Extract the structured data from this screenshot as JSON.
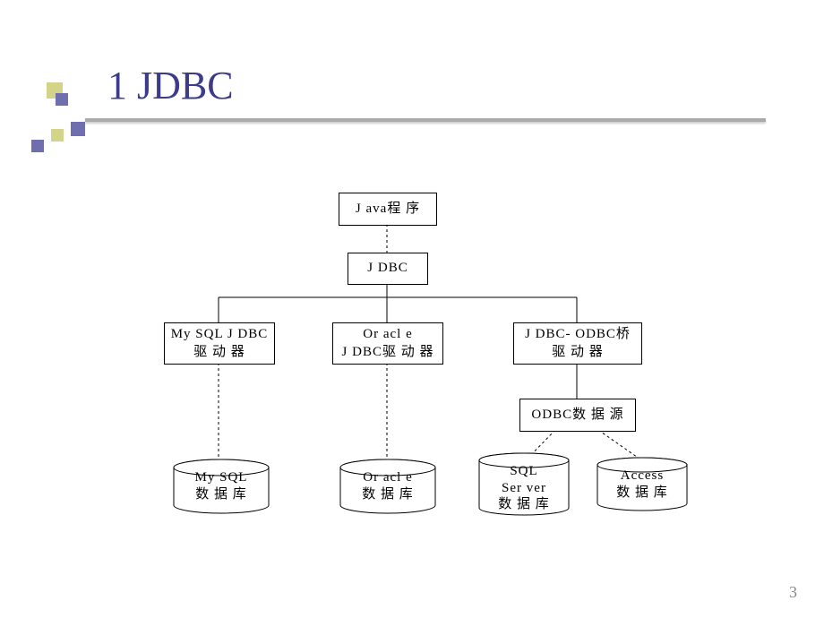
{
  "title": "1 JDBC",
  "page_number": "3",
  "nodes": {
    "java_program": "J ava程 序",
    "jdbc": "J DBC",
    "mysql_driver_l1": "My SQL J DBC",
    "mysql_driver_l2": "驱 动 器",
    "oracle_driver_l1": "Or acl e",
    "oracle_driver_l2": "J DBC驱 动 器",
    "odbc_bridge_l1": "J DBC- ODBC桥",
    "odbc_bridge_l2": "驱 动 器",
    "odbc_source": "ODBC数 据 源",
    "mysql_db_l1": "My SQL",
    "mysql_db_l2": "数 据 库",
    "oracle_db_l1": "Or acl e",
    "oracle_db_l2": "数 据 库",
    "sqlserver_db_l1": "SQL",
    "sqlserver_db_l2": "Ser ver",
    "sqlserver_db_l3": "数 据 库",
    "access_db_l1": "Access",
    "access_db_l2": "数 据 库"
  }
}
